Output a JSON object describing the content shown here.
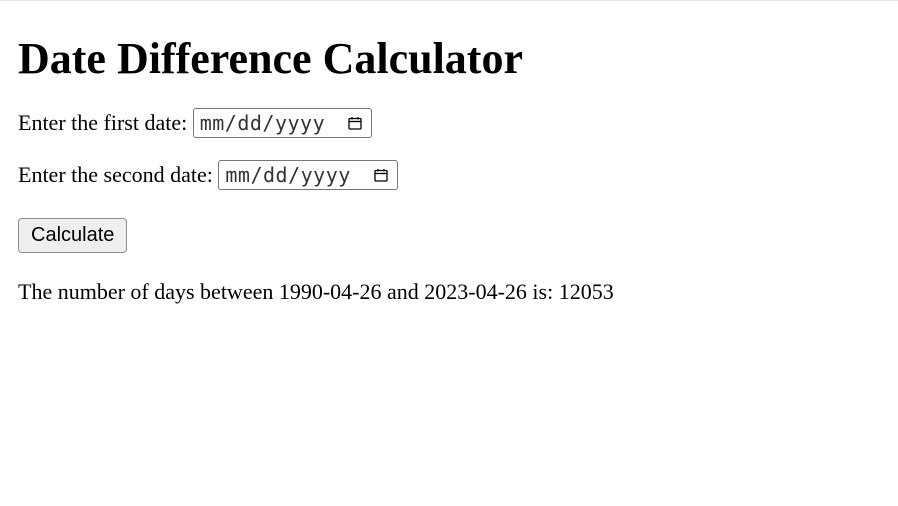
{
  "heading": "Date Difference Calculator",
  "form": {
    "first_label": "Enter the first date: ",
    "second_label": "Enter the second date: ",
    "date_placeholder": "mm/dd/yyyy",
    "calculate_label": "Calculate"
  },
  "result_text": "The number of days between 1990-04-26 and 2023-04-26 is: 12053"
}
